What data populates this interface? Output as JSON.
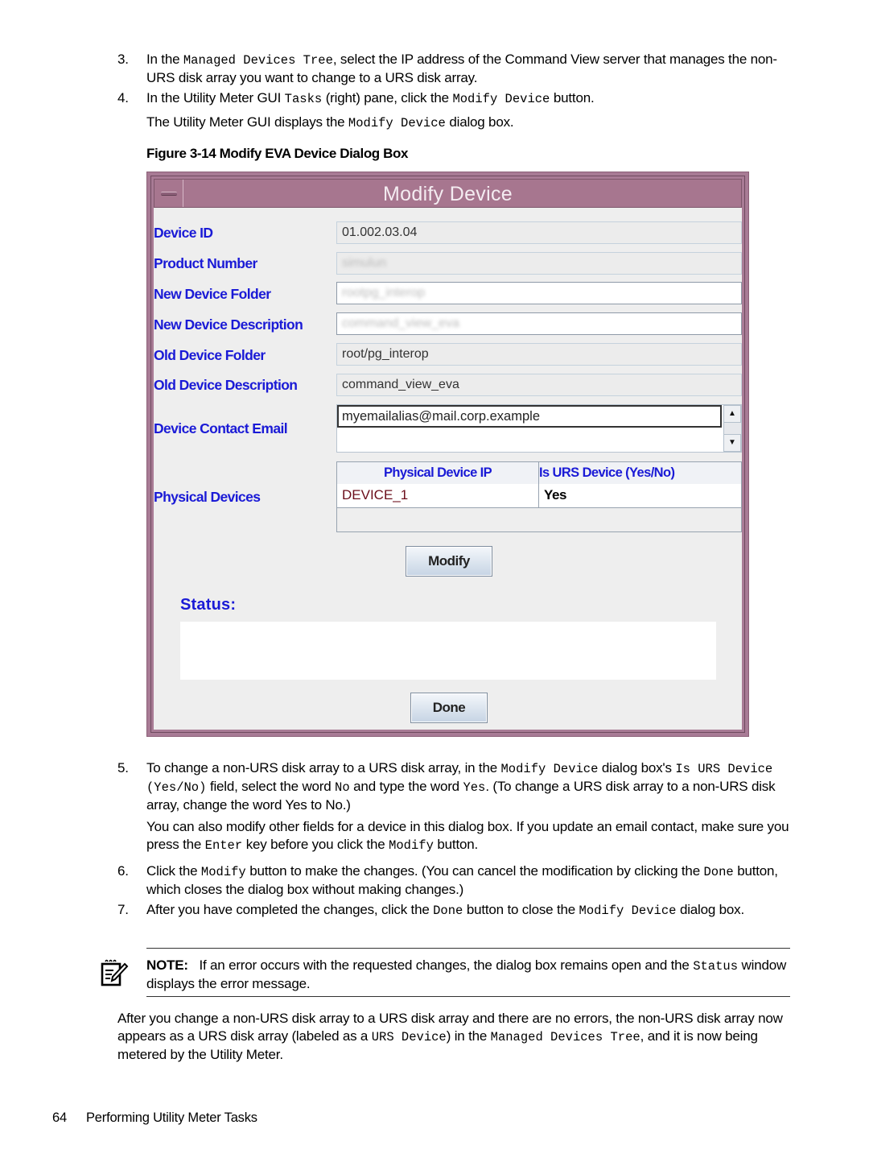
{
  "steps_before": [
    {
      "number": "3.",
      "segments": [
        {
          "t": "In the ",
          "code": false
        },
        {
          "t": "Managed Devices Tree",
          "code": true
        },
        {
          "t": ", select the IP address of the Command View server that manages the non-URS disk array you want to change to a URS disk array.",
          "code": false
        }
      ]
    },
    {
      "number": "4.",
      "segments": [
        {
          "t": "In the Utility Meter GUI ",
          "code": false
        },
        {
          "t": "Tasks",
          "code": true
        },
        {
          "t": " (right) pane, click the ",
          "code": false
        },
        {
          "t": "Modify Device",
          "code": true
        },
        {
          "t": " button.",
          "code": false
        }
      ]
    }
  ],
  "step4_followup": {
    "pre": "The Utility Meter GUI displays the ",
    "code": "Modify Device",
    "post": " dialog box."
  },
  "figure_caption": "Figure 3-14 Modify EVA Device Dialog Box",
  "dialog": {
    "title": "Modify Device",
    "fields": [
      {
        "label": "Device ID",
        "value": "01.002.03.04",
        "editable": false,
        "blurred": false
      },
      {
        "label": "Product Number",
        "value": "simulun",
        "editable": false,
        "blurred": true
      },
      {
        "label": "New Device Folder",
        "value": "rootpg_interop",
        "editable": true,
        "blurred": true
      },
      {
        "label": "New Device Description",
        "value": "command_view_eva",
        "editable": true,
        "blurred": true
      },
      {
        "label": "Old Device Folder",
        "value": "root/pg_interop",
        "editable": false,
        "blurred": false
      },
      {
        "label": "Old Device Description",
        "value": "command_view_eva",
        "editable": false,
        "blurred": false
      }
    ],
    "email": {
      "label": "Device Contact Email",
      "value": "myemailalias@mail.corp.example"
    },
    "physical_devices": {
      "label": "Physical Devices",
      "columns": [
        "Physical Device IP",
        "Is URS Device (Yes/No)"
      ],
      "rows": [
        [
          "DEVICE_1",
          "Yes"
        ]
      ]
    },
    "modify_button": "Modify",
    "status_label": "Status:",
    "status_text": "",
    "done_button": "Done",
    "colors": {
      "titlebar": "#a7768f",
      "label_blue": "#1a1ad6",
      "device_ip_text": "#6b0d1a"
    }
  },
  "steps_after": [
    {
      "number": "5.",
      "segments": [
        {
          "t": "To change a non-URS disk array to a URS disk array, in the ",
          "code": false
        },
        {
          "t": "Modify Device",
          "code": true
        },
        {
          "t": " dialog box's ",
          "code": false
        },
        {
          "t": "Is URS Device (Yes/No)",
          "code": true
        },
        {
          "t": " field, select the word ",
          "code": false
        },
        {
          "t": "No",
          "code": true
        },
        {
          "t": " and type the word ",
          "code": false
        },
        {
          "t": "Yes",
          "code": true
        },
        {
          "t": ". (To change a URS disk array to a non-URS disk array, change the word Yes to No.)",
          "code": false
        }
      ]
    }
  ],
  "step5_followup": [
    {
      "t": "You can also modify other fields for a device in this dialog box. If you update an email contact, make sure you press the ",
      "code": false
    },
    {
      "t": "Enter",
      "code": true
    },
    {
      "t": " key before you click the ",
      "code": false
    },
    {
      "t": "Modify",
      "code": true
    },
    {
      "t": " button.",
      "code": false
    }
  ],
  "steps_final": [
    {
      "number": "6.",
      "segments": [
        {
          "t": "Click the ",
          "code": false
        },
        {
          "t": "Modify",
          "code": true
        },
        {
          "t": " button to make the changes. (You can cancel the modification by clicking the ",
          "code": false
        },
        {
          "t": "Done",
          "code": true
        },
        {
          "t": " button, which closes the dialog box without making changes.)",
          "code": false
        }
      ]
    },
    {
      "number": "7.",
      "segments": [
        {
          "t": "After you have completed the changes, click the ",
          "code": false
        },
        {
          "t": "Done",
          "code": true
        },
        {
          "t": " button to close the ",
          "code": false
        },
        {
          "t": "Modify Device",
          "code": true
        },
        {
          "t": " dialog box.",
          "code": false
        }
      ]
    }
  ],
  "note": {
    "icon": "note-pencil-icon",
    "label": "NOTE:",
    "segments": [
      {
        "t": "If an error occurs with the requested changes, the dialog box remains open and the ",
        "code": false
      },
      {
        "t": "Status",
        "code": true
      },
      {
        "t": " window displays the error message.",
        "code": false
      }
    ]
  },
  "closing_paragraph": [
    {
      "t": "After you change a non-URS disk array to a URS disk array and there are no errors, the non-URS disk array now appears as a URS disk array (labeled as a ",
      "code": false
    },
    {
      "t": "URS Device",
      "code": true
    },
    {
      "t": ") in the ",
      "code": false
    },
    {
      "t": "Managed Devices Tree",
      "code": true
    },
    {
      "t": ", and it is now being metered by the Utility Meter.",
      "code": false
    }
  ],
  "footer": {
    "page_number": "64",
    "section_title": "Performing Utility Meter Tasks"
  }
}
